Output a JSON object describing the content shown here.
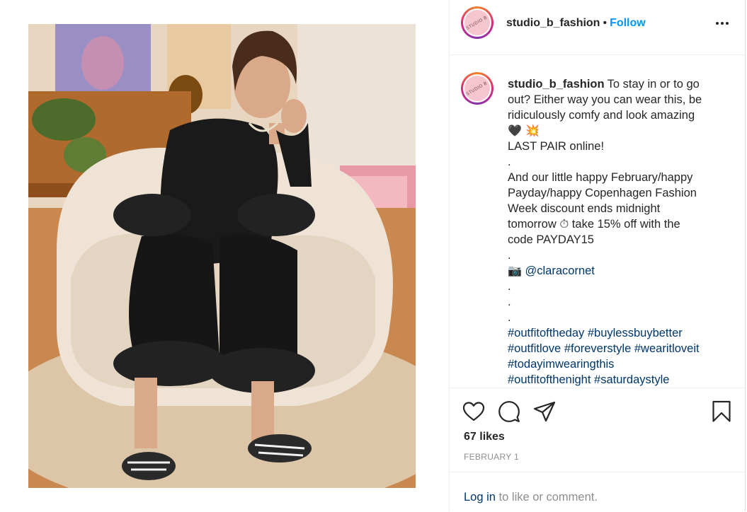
{
  "post": {
    "username": "studio_b_fashion",
    "avatar_text": "STUDIO B",
    "follow_label": "Follow",
    "separator": "•",
    "caption": {
      "text_line_1": "To stay in or to go",
      "lines": [
        "out? Either way you can wear this, be",
        "ridiculously comfy and look amazing",
        "🖤 💥",
        "LAST PAIR online!",
        ".",
        "And our little happy February/happy",
        "Payday/happy Copenhagen Fashion",
        "Week discount ends midnight",
        "tomorrow ⏱ take 15% off with the",
        "code PAYDAY15",
        "."
      ],
      "camera_emoji": "📷",
      "mention": "@claracornet",
      "dots": [
        ".",
        ".",
        "."
      ],
      "hashtag_lines": [
        [
          "#outfitoftheday",
          "#buylessbuybetter"
        ],
        [
          "#outfitlove",
          "#foreverstyle",
          "#wearitloveit"
        ],
        [
          "#todayimwearingthis"
        ],
        [
          "#outfitofthenight",
          "#saturdaystyle"
        ]
      ]
    },
    "likes": "67 likes",
    "date": "FEBRUARY 1",
    "login": {
      "link": "Log in",
      "rest": " to like or comment."
    }
  },
  "icons": {
    "more": "more-options-icon",
    "like": "heart-icon",
    "comment": "comment-icon",
    "share": "send-icon",
    "save": "bookmark-icon"
  },
  "colors": {
    "follow": "#0095f6",
    "link": "#00376b",
    "muted": "#8e8e8e",
    "text": "#262626"
  }
}
